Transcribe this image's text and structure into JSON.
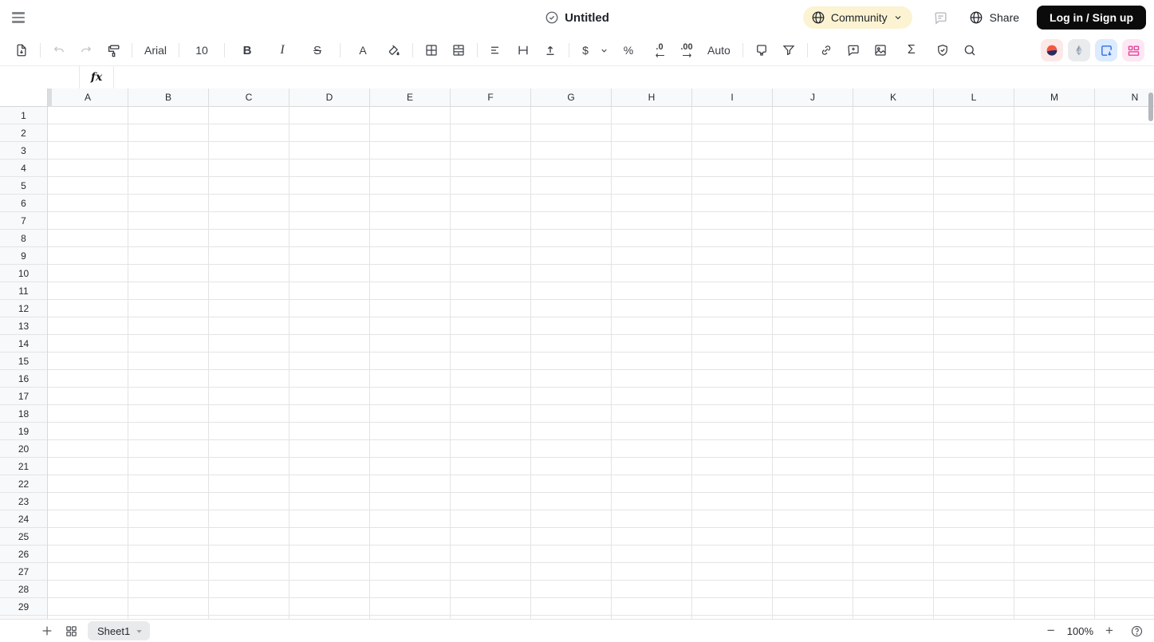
{
  "header": {
    "title": "Untitled",
    "community_label": "Community",
    "share_label": "Share",
    "login_label": "Log in / Sign up"
  },
  "toolbar": {
    "font_family": "Arial",
    "font_size": "10",
    "bold_label": "B",
    "italic_label": "I",
    "strikethrough_label": "S",
    "text_color_label": "A",
    "currency_label": "$",
    "percent_label": "%",
    "decrease_decimal_label": ".0",
    "increase_decimal_label": ".00",
    "number_format_label": "Auto",
    "sum_label": "Σ"
  },
  "formula_bar": {
    "name_box_value": "",
    "fx_label": "fx",
    "input_value": ""
  },
  "grid": {
    "columns": [
      "A",
      "B",
      "C",
      "D",
      "E",
      "F",
      "G",
      "H",
      "I",
      "J",
      "K",
      "L",
      "M",
      "N"
    ],
    "rows": [
      "1",
      "2",
      "3",
      "4",
      "5",
      "6",
      "7",
      "8",
      "9",
      "10",
      "11",
      "12",
      "13",
      "14",
      "15",
      "16",
      "17",
      "18",
      "19",
      "20",
      "21",
      "22",
      "23",
      "24",
      "25",
      "26",
      "27",
      "28",
      "29"
    ]
  },
  "footer": {
    "sheet_tab_label": "Sheet1",
    "zoom_out_label": "−",
    "zoom_level": "100%",
    "zoom_in_label": "+"
  },
  "colors": {
    "community_bg": "#fbf3d2",
    "login_bg": "#0b0b0c",
    "active_tool_bg": "#dcebfd",
    "plugin_planet_bg": "#fbe9e7",
    "plugin_planet_orange": "#f3583f",
    "plugin_planet_navy": "#272c66",
    "plugin_eth_bg": "#e9ebed",
    "plugin_eth_glyph": "#8e97ad",
    "plugin_export_bg": "#dcebfd",
    "plugin_export_glyph": "#2f6ced",
    "plugin_layout_bg": "#fde7f3",
    "plugin_layout_glyph": "#e3439c",
    "header_bg": "#f8f9fa",
    "gridline": "#e3e4e6"
  }
}
